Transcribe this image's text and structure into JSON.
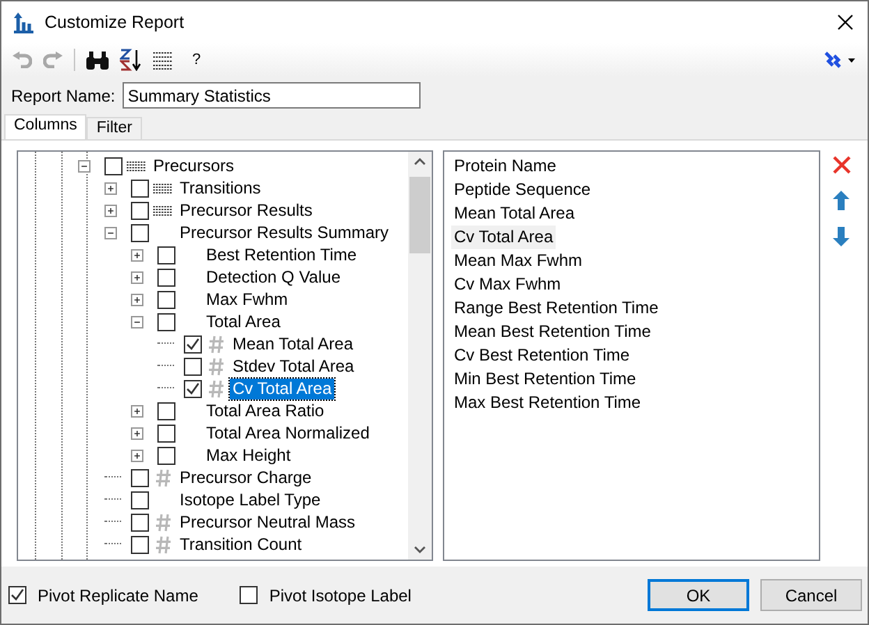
{
  "window": {
    "title": "Customize Report"
  },
  "toolbar": {
    "help": "?"
  },
  "report_name": {
    "label": "Report Name:",
    "value": "Summary Statistics"
  },
  "tabs": [
    {
      "label": "Columns",
      "selected": true
    },
    {
      "label": "Filter",
      "selected": false
    }
  ],
  "tree": [
    {
      "label": "Precursors",
      "kind": "table",
      "checked": false,
      "selected": false,
      "expanded": true,
      "children": [
        {
          "label": "Transitions",
          "kind": "table",
          "checked": false,
          "selected": false,
          "expanded": false
        },
        {
          "label": "Precursor Results",
          "kind": "table",
          "checked": false,
          "selected": false,
          "expanded": false
        },
        {
          "label": "Precursor Results Summary",
          "kind": "plain",
          "checked": false,
          "selected": false,
          "expanded": true,
          "children": [
            {
              "label": "Best Retention Time",
              "kind": "plain",
              "checked": false,
              "selected": false,
              "expanded": false
            },
            {
              "label": "Detection Q Value",
              "kind": "plain",
              "checked": false,
              "selected": false,
              "expanded": false
            },
            {
              "label": "Max Fwhm",
              "kind": "plain",
              "checked": false,
              "selected": false,
              "expanded": false
            },
            {
              "label": "Total Area",
              "kind": "plain",
              "checked": false,
              "selected": false,
              "expanded": true,
              "children": [
                {
                  "label": "Mean Total Area",
                  "kind": "number",
                  "checked": true,
                  "selected": false
                },
                {
                  "label": "Stdev Total Area",
                  "kind": "number",
                  "checked": false,
                  "selected": false
                },
                {
                  "label": "Cv Total Area",
                  "kind": "number",
                  "checked": true,
                  "selected": true
                }
              ]
            },
            {
              "label": "Total Area Ratio",
              "kind": "plain",
              "checked": false,
              "selected": false,
              "expanded": false
            },
            {
              "label": "Total Area Normalized",
              "kind": "plain",
              "checked": false,
              "selected": false,
              "expanded": false
            },
            {
              "label": "Max Height",
              "kind": "plain",
              "checked": false,
              "selected": false,
              "expanded": false
            }
          ]
        },
        {
          "label": "Precursor Charge",
          "kind": "number",
          "checked": false,
          "selected": false
        },
        {
          "label": "Isotope Label Type",
          "kind": "plain",
          "checked": false,
          "selected": false
        },
        {
          "label": "Precursor Neutral Mass",
          "kind": "number",
          "checked": false,
          "selected": false
        },
        {
          "label": "Transition Count",
          "kind": "number",
          "checked": false,
          "selected": false
        }
      ]
    }
  ],
  "columns": [
    {
      "label": "Protein Name",
      "selected": false
    },
    {
      "label": "Peptide Sequence",
      "selected": false
    },
    {
      "label": "Mean Total Area",
      "selected": false
    },
    {
      "label": "Cv Total Area",
      "selected": true
    },
    {
      "label": "Mean Max Fwhm",
      "selected": false
    },
    {
      "label": "Cv Max Fwhm",
      "selected": false
    },
    {
      "label": "Range Best Retention Time",
      "selected": false
    },
    {
      "label": "Mean Best Retention Time",
      "selected": false
    },
    {
      "label": "Cv Best Retention Time",
      "selected": false
    },
    {
      "label": "Min Best Retention Time",
      "selected": false
    },
    {
      "label": "Max Best Retention Time",
      "selected": false
    }
  ],
  "options": [
    {
      "label": "Pivot Replicate Name",
      "checked": true
    },
    {
      "label": "Pivot Isotope Label",
      "checked": false
    }
  ],
  "buttons": [
    {
      "label": "OK",
      "default": true
    },
    {
      "label": "Cancel",
      "default": false
    }
  ]
}
